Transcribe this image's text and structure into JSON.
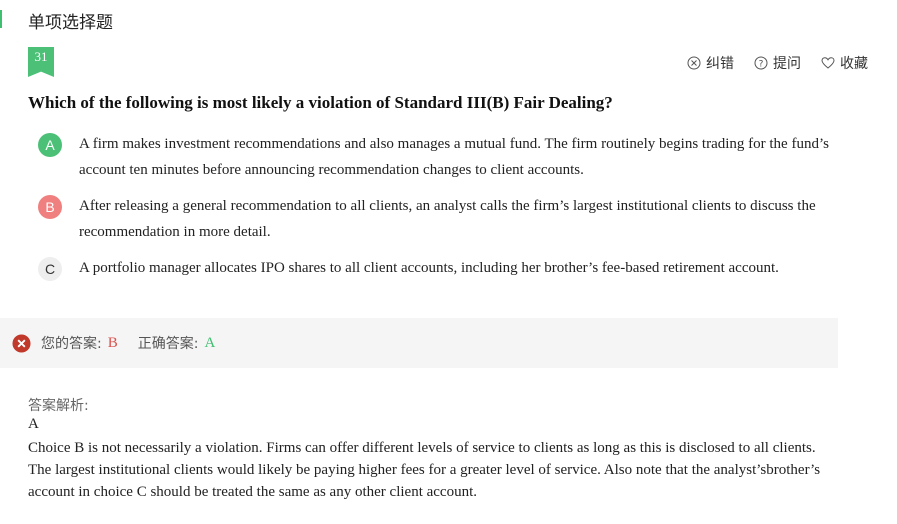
{
  "section": {
    "title": "单项选择题"
  },
  "question": {
    "number": "31",
    "text": "Which of the following is most likely a violation of Standard III(B) Fair Dealing?"
  },
  "actions": {
    "report_label": "纠错",
    "ask_label": "提问",
    "favorite_label": "收藏"
  },
  "options": [
    {
      "letter": "A",
      "text": "A firm makes investment recommendations and also manages a mutual fund. The firm routinely begins trading for the fund’s account ten minutes before announcing recommendation changes to client accounts."
    },
    {
      "letter": "B",
      "text": "After releasing a general recommendation to all clients, an analyst calls the firm’s largest institutional clients to discuss the recommendation in more detail."
    },
    {
      "letter": "C",
      "text": "A portfolio manager allocates IPO shares to all client accounts, including her brother’s fee-based retirement account."
    }
  ],
  "result": {
    "your_answer_label": "您的答案:",
    "your_answer": "B",
    "correct_answer_label": "正确答案:",
    "correct_answer": "A"
  },
  "explanation": {
    "label": "答案解析:",
    "answer": "A",
    "text": "Choice B is not necessarily a violation. Firms can offer different levels of service to clients as long as this is disclosed to all clients. The largest institutional clients would likely be paying higher fees for a greater level of service. Also note that the analyst’sbrother’s account in choice C should be treated the same as any other client account."
  },
  "colors": {
    "correct_green": "#4cc077",
    "wrong_red": "#f08080",
    "error_icon": "#c0392b"
  }
}
